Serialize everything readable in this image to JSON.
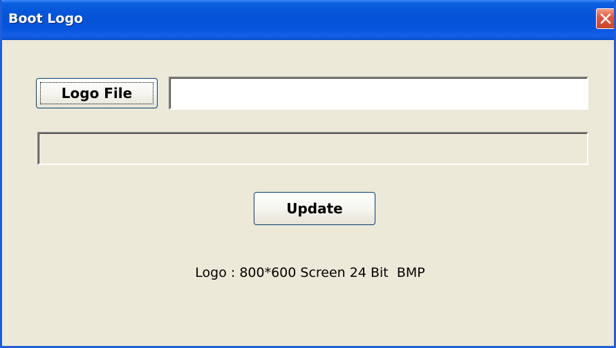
{
  "window": {
    "title": "Boot Logo",
    "close_icon": "close-icon"
  },
  "form": {
    "logo_file_button_label": "Logo File",
    "logo_file_path_value": "",
    "status_text": "",
    "update_button_label": "Update",
    "info_text": "Logo : 800*600 Screen 24 Bit  BMP"
  },
  "colors": {
    "titlebar": "#0653d8",
    "background": "#ece9d8",
    "close_button": "#e2593d",
    "button_border": "#003c74"
  }
}
